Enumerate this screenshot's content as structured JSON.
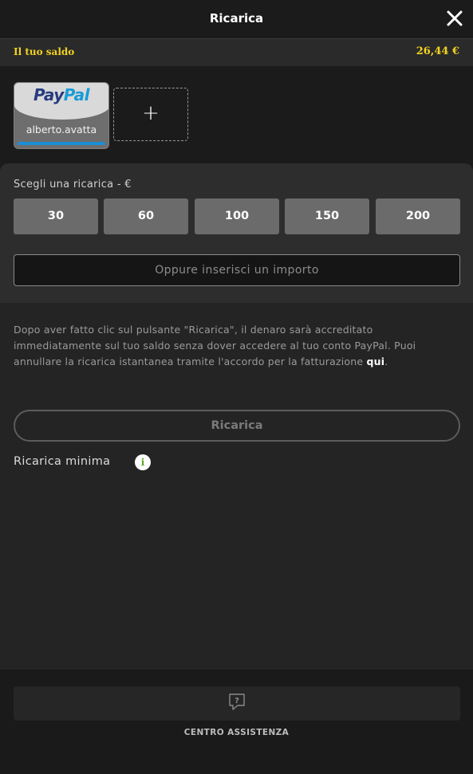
{
  "header": {
    "title": "Ricarica",
    "close_icon": "close-icon"
  },
  "balance": {
    "label": "Il tuo saldo",
    "value": "26,44 €",
    "color": "#f2d220"
  },
  "payment_methods": {
    "paypal": {
      "logo_pay": "Pay",
      "logo_pal": "Pal",
      "account": "alberto.avatta"
    },
    "add_symbol": "+"
  },
  "amount_selector": {
    "label": "Scegli una ricarica - €",
    "options": [
      "30",
      "60",
      "100",
      "150",
      "200"
    ],
    "custom_placeholder": "Oppure inserisci un importo"
  },
  "info": {
    "text": "Dopo aver fatto clic sul pulsante \"Ricarica\", il denaro sarà accreditato immediatamente sul tuo saldo senza dover accedere al tuo conto PayPal. Puoi annullare la ricarica istantanea tramite l'accordo per la fatturazione ",
    "link": "qui",
    "end": "."
  },
  "submit": {
    "label": "Ricarica"
  },
  "minimum": {
    "label": "Ricarica minima",
    "icon_glyph": "i"
  },
  "footer": {
    "help_label": "CENTRO ASSISTENZA",
    "help_icon": "help-chat-icon"
  }
}
